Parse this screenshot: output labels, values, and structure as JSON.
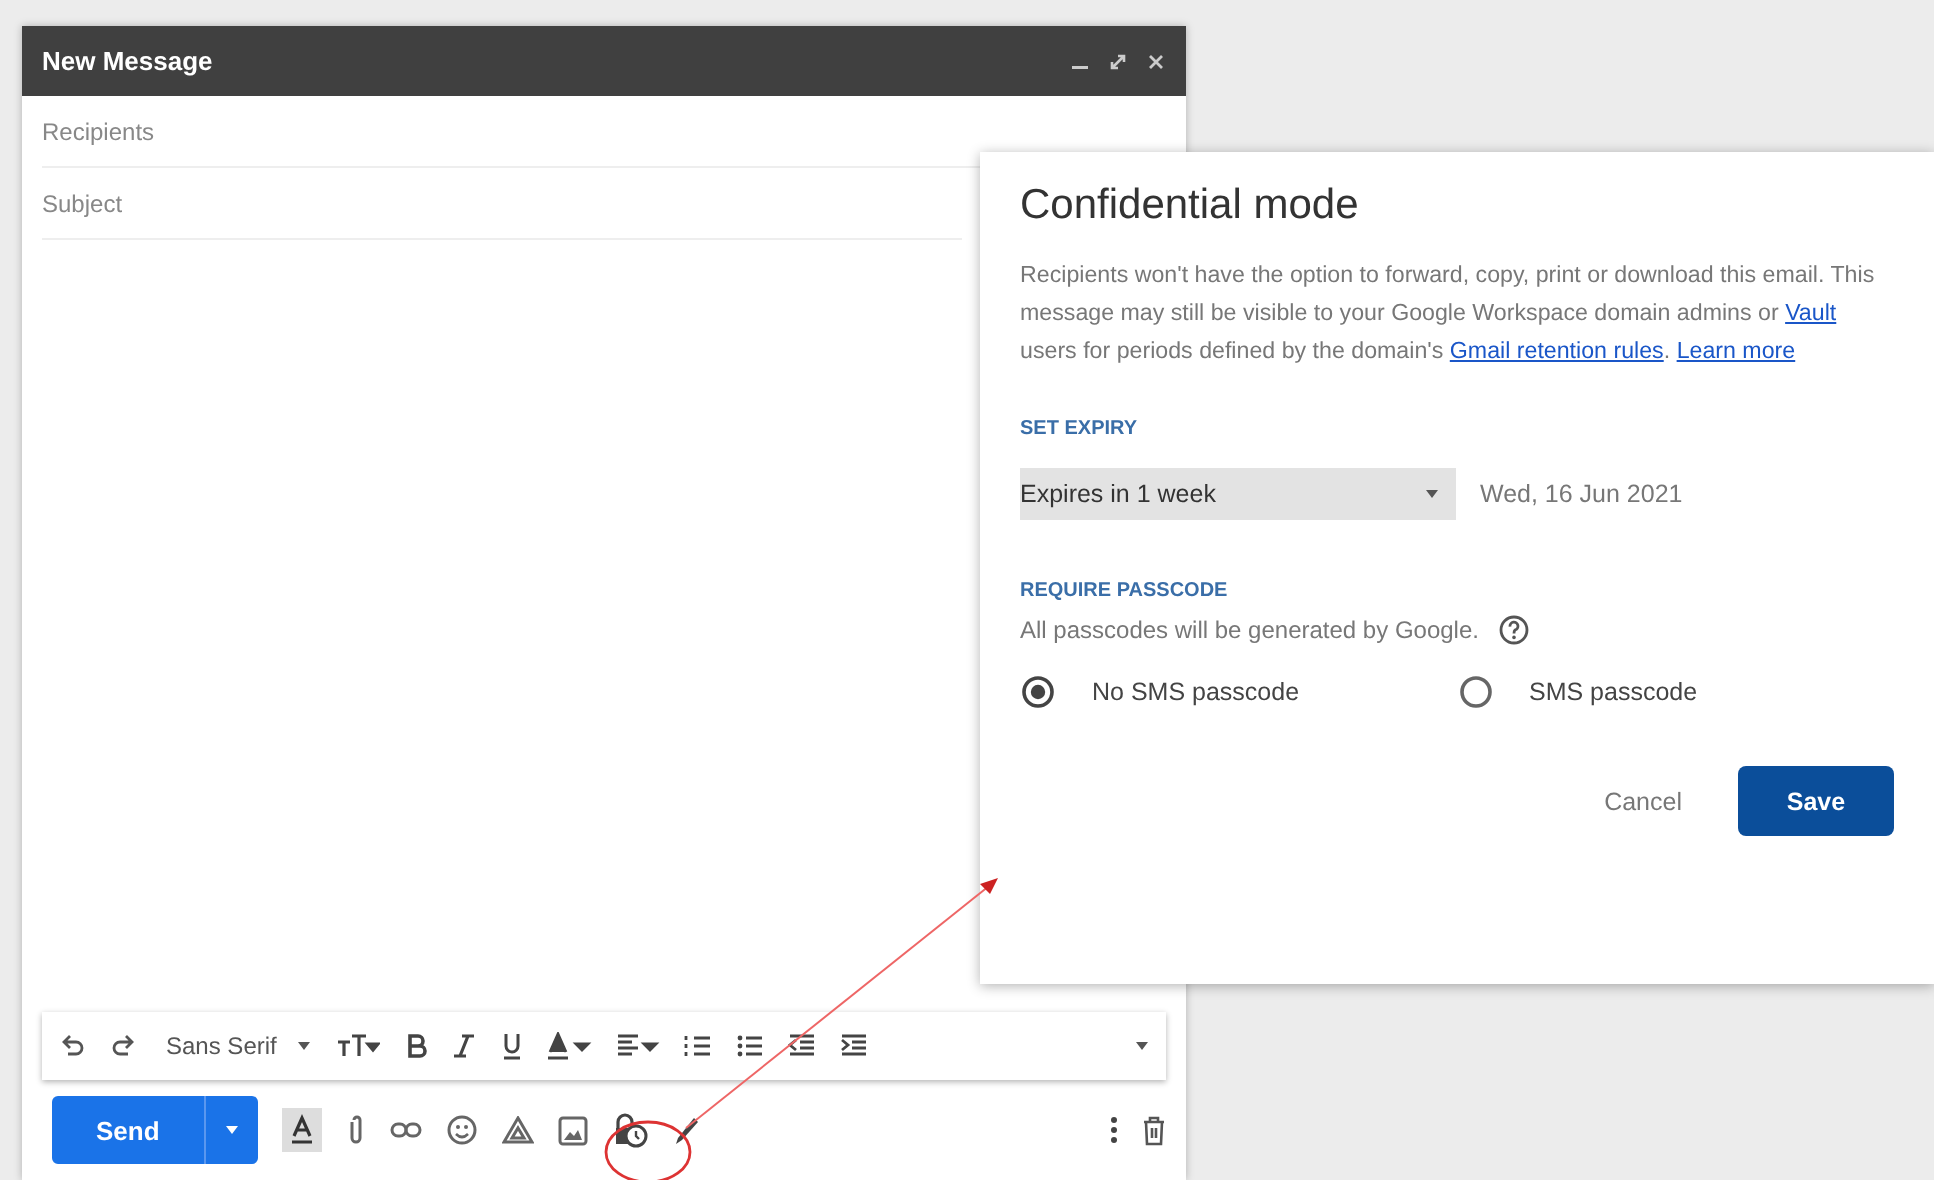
{
  "compose": {
    "title": "New Message",
    "recipients": {
      "placeholder": "Recipients"
    },
    "subject": {
      "placeholder": "Subject"
    },
    "format_toolbar": {
      "font": "Sans Serif"
    },
    "send_button": "Send"
  },
  "dialog": {
    "title": "Confidential mode",
    "description": [
      {
        "kind": "text",
        "text": "Recipients won't have the option to forward, copy, print or download this email. This message may still be visible to your Google Workspace domain admins or "
      },
      {
        "kind": "link",
        "text": "Vault"
      },
      {
        "kind": "text",
        "text": " users for periods defined by the domain's "
      },
      {
        "kind": "link",
        "text": "Gmail retention rules"
      },
      {
        "kind": "text",
        "text": ". "
      },
      {
        "kind": "link",
        "text": "Learn more"
      }
    ],
    "expiry_heading": "SET EXPIRY",
    "expiry": {
      "value": "Expires in 1 week",
      "date": "Wed, 16 Jun 2021"
    },
    "passcode_heading": "REQUIRE PASSCODE",
    "passcode_note": "All passcodes will be generated by Google.",
    "passcode_options": [
      {
        "label": "No SMS passcode",
        "selected": true
      },
      {
        "label": "SMS passcode",
        "selected": false
      }
    ],
    "buttons": {
      "cancel": "Cancel",
      "save": "Save"
    }
  }
}
